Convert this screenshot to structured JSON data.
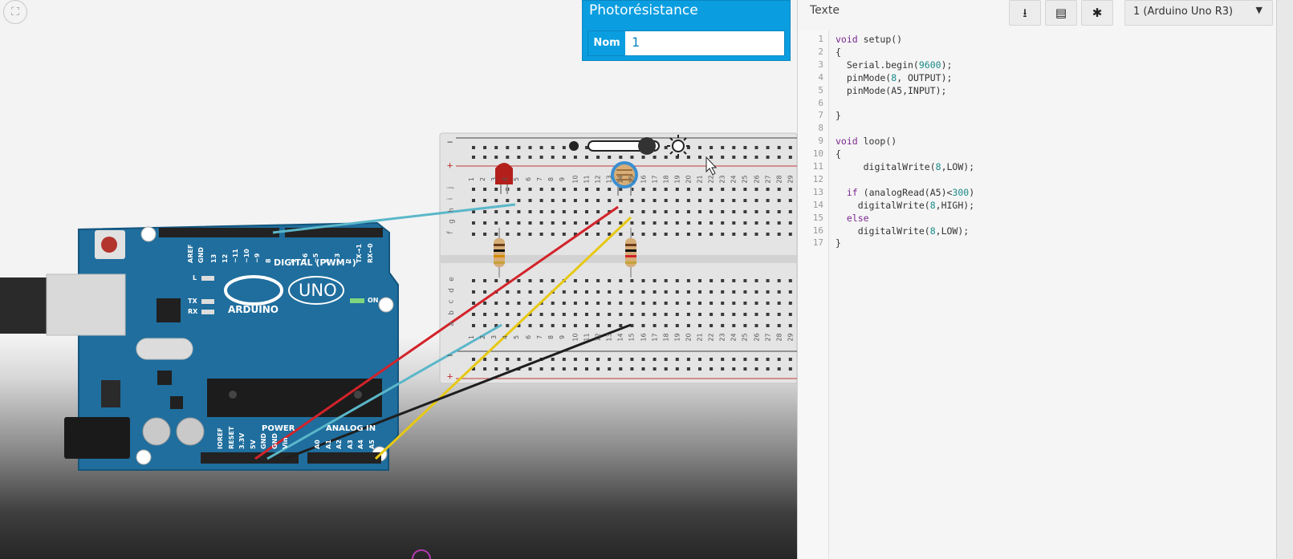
{
  "canvas": {
    "breadboard": {
      "minus_label": "−",
      "plus_label": "+",
      "row_letters_top": [
        "j",
        "i",
        "h",
        "g",
        "f"
      ],
      "row_letters_bottom": [
        "e",
        "d",
        "c",
        "b",
        "a"
      ],
      "column_numbers": [
        "1",
        "2",
        "3",
        "4",
        "5",
        "6",
        "7",
        "8",
        "9",
        "10",
        "11",
        "12",
        "13",
        "14",
        "15",
        "16",
        "17",
        "18",
        "19",
        "20",
        "21",
        "22",
        "23",
        "24",
        "25",
        "26",
        "27",
        "28",
        "29"
      ]
    },
    "arduino": {
      "digital_label": "DIGITAL (PWM~)",
      "brand": "ARDUINO",
      "model": "UNO",
      "power_label": "POWER",
      "analog_label": "ANALOG IN",
      "on_label": "ON",
      "l_label": "L",
      "tx_label": "TX",
      "rx_label": "RX",
      "aref": "AREF",
      "gnd": "GND",
      "digital_pins": [
        "13",
        "12",
        "~11",
        "~10",
        "~9",
        "8",
        "7",
        "~6",
        "~5",
        "4",
        "~3",
        "2",
        "TX→1",
        "RX←0"
      ],
      "power_pins": [
        "IOREF",
        "RESET",
        "3.3V",
        "5V",
        "GND",
        "GND",
        "Vin"
      ],
      "analog_pins": [
        "A0",
        "A1",
        "A2",
        "A3",
        "A4",
        "A5"
      ]
    }
  },
  "property_panel": {
    "title": "Photorésistance",
    "field_label": "Nom",
    "field_value": "1"
  },
  "code_panel": {
    "mode_label": "Texte",
    "toolbar_icons": [
      "download-icon",
      "library-icon",
      "debug-bug-icon"
    ],
    "board_select": "1 (Arduino Uno R3)",
    "lines": [
      [
        {
          "t": "void",
          "c": "kw"
        },
        {
          "t": " setup()",
          "c": ""
        }
      ],
      [
        {
          "t": "{",
          "c": ""
        }
      ],
      [
        {
          "t": "  Serial.begin(",
          "c": ""
        },
        {
          "t": "9600",
          "c": "num"
        },
        {
          "t": ");",
          "c": ""
        }
      ],
      [
        {
          "t": "  pinMode(",
          "c": ""
        },
        {
          "t": "8",
          "c": "num"
        },
        {
          "t": ", OUTPUT);",
          "c": ""
        }
      ],
      [
        {
          "t": "  pinMode(A5,INPUT);",
          "c": ""
        }
      ],
      [
        {
          "t": "",
          "c": ""
        }
      ],
      [
        {
          "t": "}",
          "c": ""
        }
      ],
      [
        {
          "t": "",
          "c": ""
        }
      ],
      [
        {
          "t": "void",
          "c": "kw"
        },
        {
          "t": " loop()",
          "c": ""
        }
      ],
      [
        {
          "t": "{",
          "c": ""
        }
      ],
      [
        {
          "t": "     digitalWrite(",
          "c": ""
        },
        {
          "t": "8",
          "c": "num"
        },
        {
          "t": ",LOW);",
          "c": ""
        }
      ],
      [
        {
          "t": "",
          "c": ""
        }
      ],
      [
        {
          "t": "  ",
          "c": ""
        },
        {
          "t": "if",
          "c": "kw"
        },
        {
          "t": " (analogRead(A5)<",
          "c": ""
        },
        {
          "t": "300",
          "c": "num"
        },
        {
          "t": ")",
          "c": ""
        }
      ],
      [
        {
          "t": "    digitalWrite(",
          "c": ""
        },
        {
          "t": "8",
          "c": "num"
        },
        {
          "t": ",HIGH);",
          "c": ""
        }
      ],
      [
        {
          "t": "  ",
          "c": ""
        },
        {
          "t": "else",
          "c": "kw"
        }
      ],
      [
        {
          "t": "    digitalWrite(",
          "c": ""
        },
        {
          "t": "8",
          "c": "num"
        },
        {
          "t": ",LOW);",
          "c": ""
        }
      ],
      [
        {
          "t": "}",
          "c": ""
        }
      ]
    ]
  },
  "colors": {
    "accent": "#0a9ee0",
    "board_blue": "#1f6e9e",
    "wire_red": "#d2232a",
    "wire_yellow": "#e7c813",
    "wire_cyan": "#5bb7c9",
    "wire_black": "#1e1e1e"
  }
}
